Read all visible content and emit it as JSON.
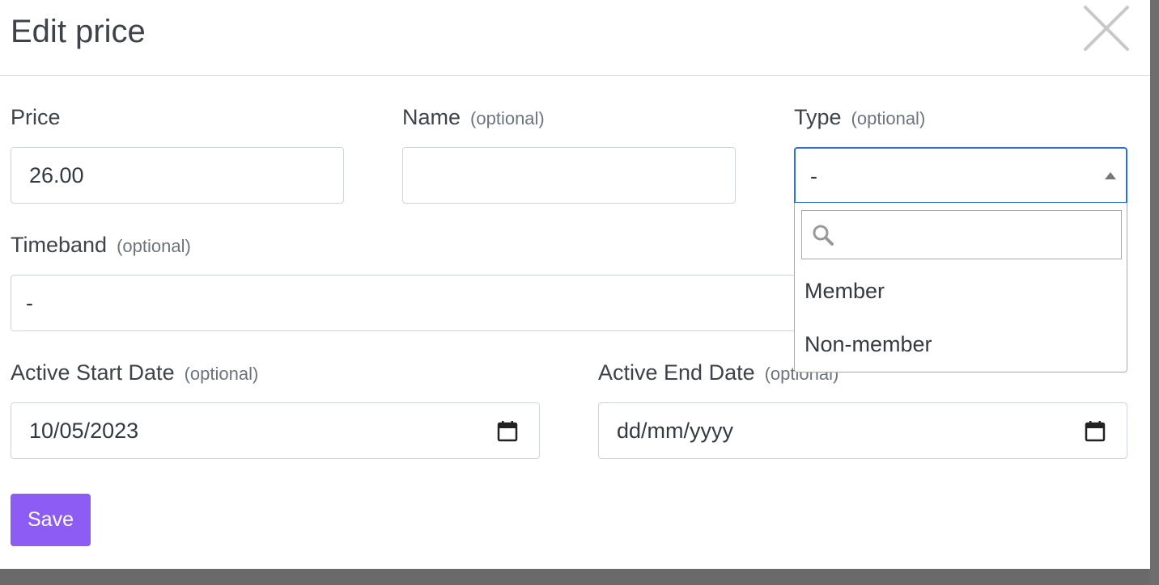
{
  "modal": {
    "title": "Edit price",
    "save_label": "Save"
  },
  "fields": {
    "price": {
      "label": "Price",
      "value": "26.00"
    },
    "name": {
      "label": "Name",
      "optional": "(optional)",
      "value": ""
    },
    "type": {
      "label": "Type",
      "optional": "(optional)",
      "value": "-"
    },
    "timeband": {
      "label": "Timeband",
      "optional": "(optional)",
      "value": "-"
    },
    "start_date": {
      "label": "Active Start Date",
      "optional": "(optional)",
      "value": "10/05/2023"
    },
    "end_date": {
      "label": "Active End Date",
      "optional": "(optional)",
      "placeholder": "dd/mm/yyyy"
    }
  },
  "type_dropdown": {
    "search_value": "",
    "options": [
      "Member",
      "Non-member"
    ]
  },
  "icons": {
    "close": "close-icon",
    "search": "search-icon",
    "calendar": "calendar-icon",
    "caret": "caret-up-icon"
  },
  "colors": {
    "primary": "#8c5cf5",
    "focus": "#2a6fdb"
  }
}
